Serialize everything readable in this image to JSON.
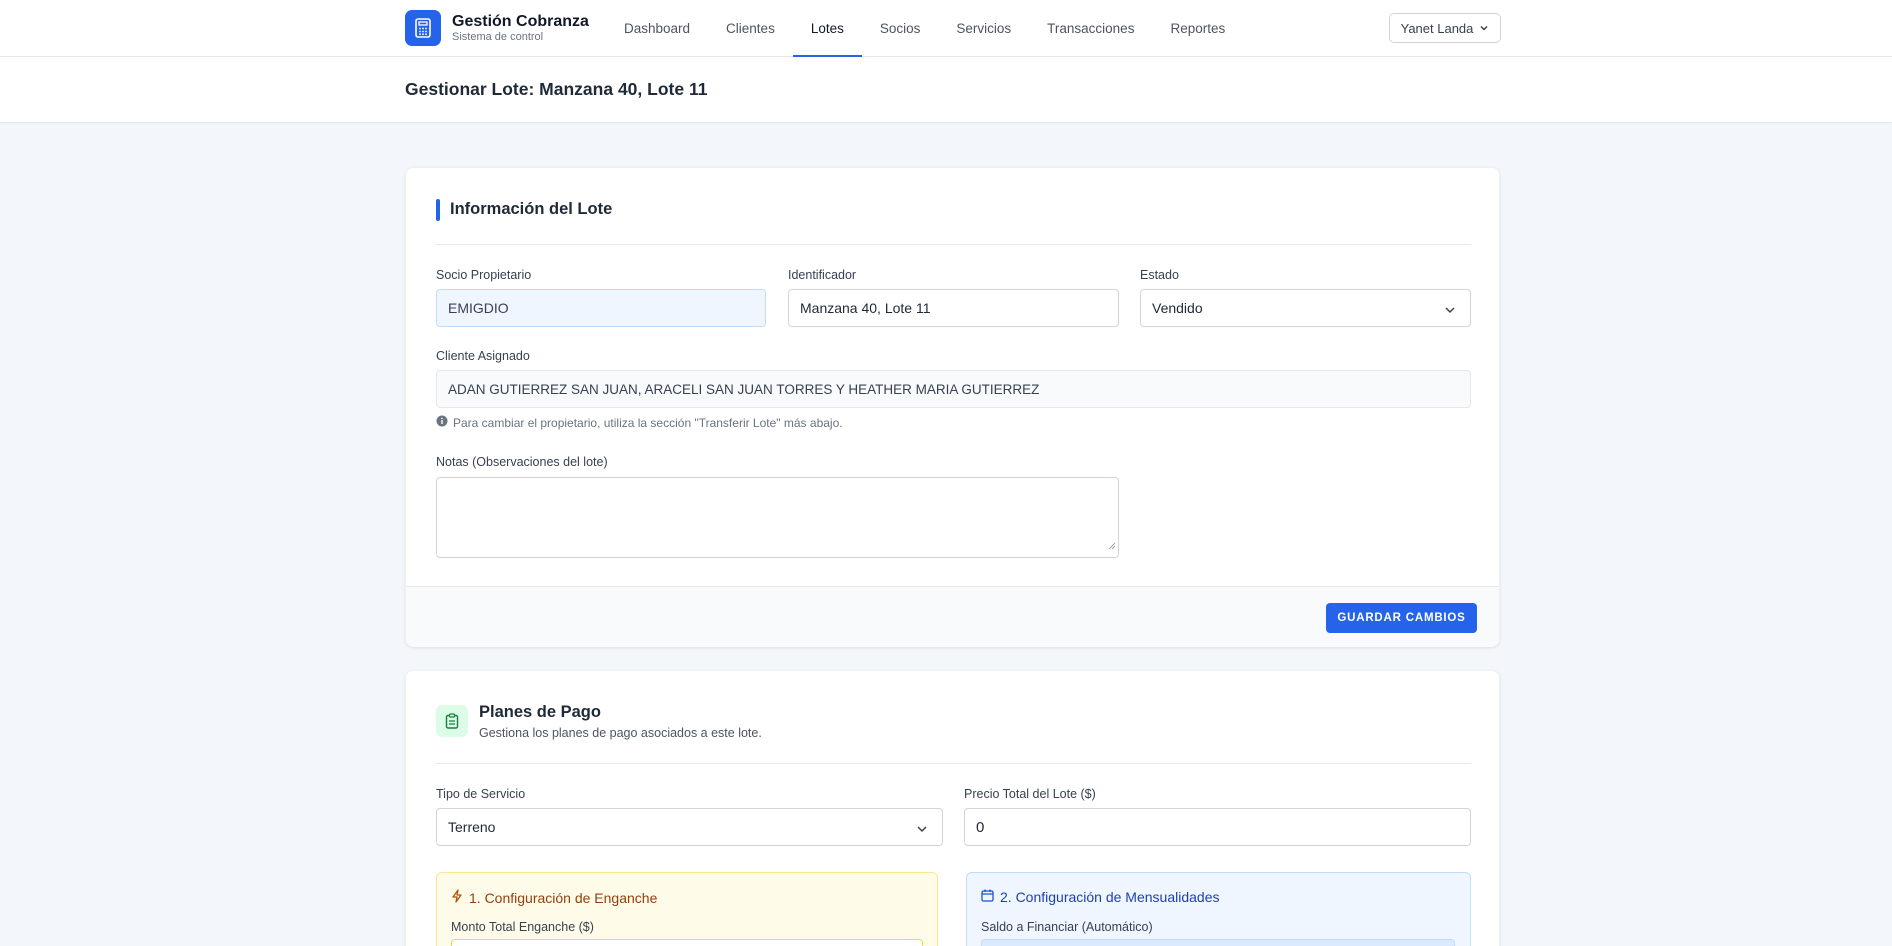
{
  "app": {
    "title": "Gestión Cobranza",
    "subtitle": "Sistema de control"
  },
  "nav": {
    "items": [
      {
        "label": "Dashboard",
        "active": false
      },
      {
        "label": "Clientes",
        "active": false
      },
      {
        "label": "Lotes",
        "active": true
      },
      {
        "label": "Socios",
        "active": false
      },
      {
        "label": "Servicios",
        "active": false
      },
      {
        "label": "Transacciones",
        "active": false
      },
      {
        "label": "Reportes",
        "active": false
      }
    ],
    "user": "Yanet Landa"
  },
  "page": {
    "title": "Gestionar Lote: Manzana 40, Lote 11"
  },
  "lot_info": {
    "section_title": "Información del Lote",
    "owner_label": "Socio Propietario",
    "owner_value": "EMIGDIO",
    "identifier_label": "Identificador",
    "identifier_value": "Manzana 40, Lote 11",
    "status_label": "Estado",
    "status_value": "Vendido",
    "client_label": "Cliente Asignado",
    "client_value": "ADAN GUTIERREZ SAN JUAN, ARACELI SAN JUAN TORRES Y HEATHER MARIA GUTIERREZ",
    "hint": "Para cambiar el propietario, utiliza la sección \"Transferir Lote\" más abajo.",
    "notes_label": "Notas (Observaciones del lote)",
    "notes_value": "",
    "save_label": "GUARDAR CAMBIOS"
  },
  "payment_plans": {
    "title": "Planes de Pago",
    "subtitle": "Gestiona los planes de pago asociados a este lote.",
    "service_type_label": "Tipo de Servicio",
    "service_type_value": "Terreno",
    "total_price_label": "Precio Total del Lote ($)",
    "total_price_value": "0",
    "down_payment_title": "1. Configuración de Enganche",
    "down_payment_amount_label": "Monto Total Enganche ($)",
    "monthly_title": "2. Configuración de Mensualidades",
    "monthly_balance_label": "Saldo a Financiar (Automático)"
  },
  "colors": {
    "primary": "#2563eb",
    "background": "#f3f6fa",
    "down_payment_bg": "#fefce8",
    "monthly_bg": "#eff6ff"
  },
  "icons": {
    "brand": "calculator-icon",
    "user_menu": "chevron-down-icon",
    "hint": "info-circle-icon",
    "plans": "clipboard-icon",
    "down_payment": "lightning-icon",
    "monthly": "calendar-icon"
  }
}
